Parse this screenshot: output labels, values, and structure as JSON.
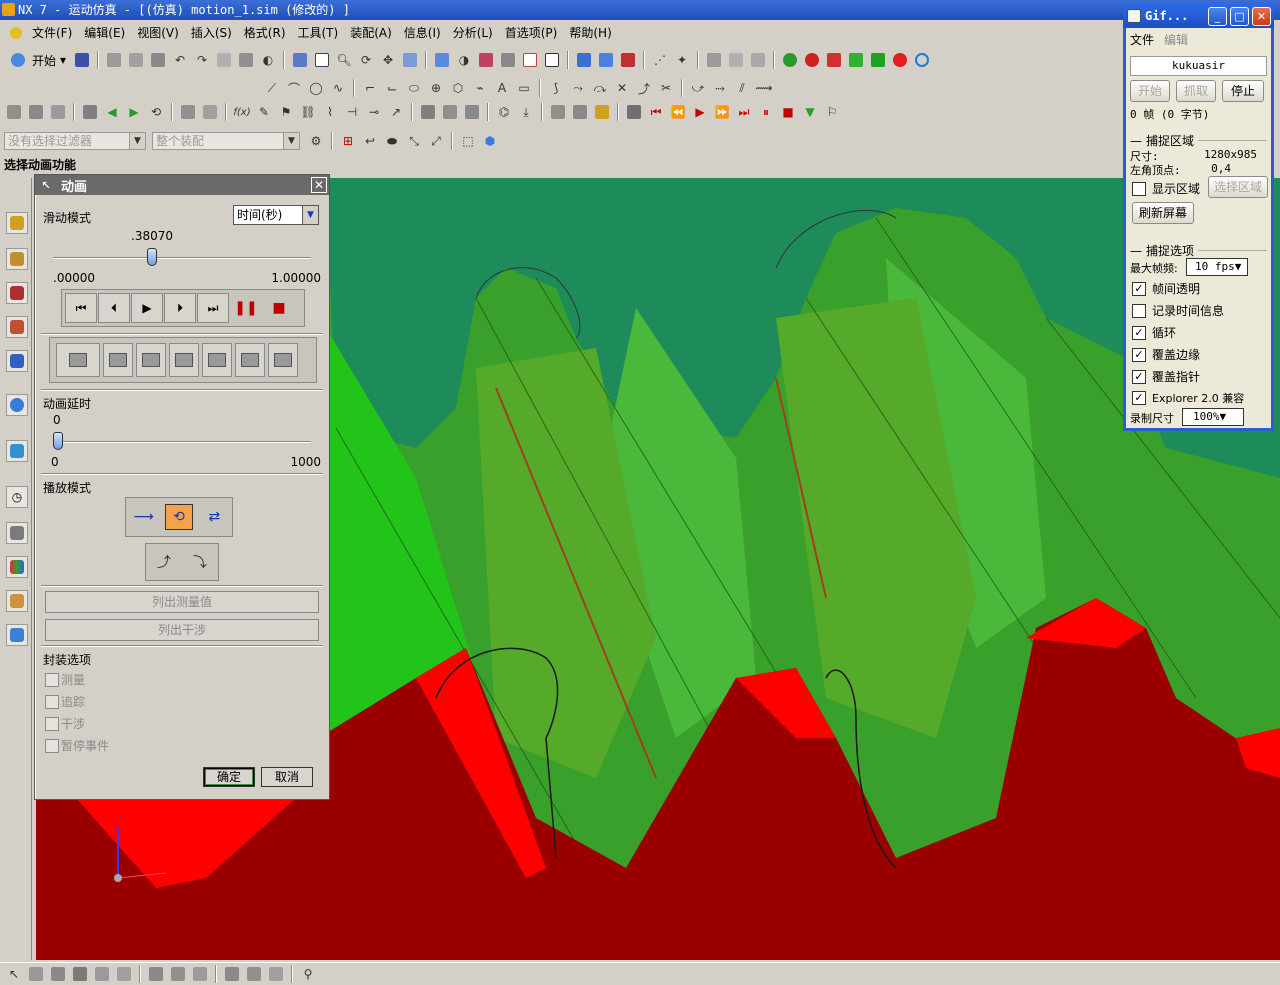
{
  "window": {
    "title": "NX 7 - 运动仿真 - [(仿真) motion_1.sim (修改的) ]"
  },
  "menu": [
    "文件(F)",
    "编辑(E)",
    "视图(V)",
    "插入(S)",
    "格式(R)",
    "工具(T)",
    "装配(A)",
    "信息(I)",
    "分析(L)",
    "首选项(P)",
    "帮助(H)"
  ],
  "toolbar": {
    "start_label": "开始"
  },
  "filter": {
    "selection_filter": "没有选择过滤器",
    "assembly_scope": "整个装配"
  },
  "cue_line": "选择动画功能",
  "animation_dialog": {
    "title": "动画",
    "slide_mode_label": "滑动模式",
    "slide_mode_value": "时间(秒)",
    "time_value": ".38070",
    "time_fraction": 0.3807,
    "time_min": ".00000",
    "time_max": "1.00000",
    "delay_label": "动画延时",
    "delay_value": "0",
    "delay_min": "0",
    "delay_max": "1000",
    "delay_fraction": 0.0,
    "playback_mode_label": "播放模式",
    "list_measurements_label": "列出测量值",
    "list_interference_label": "列出干涉",
    "package_options_label": "封装选项",
    "package_options": [
      "测量",
      "追踪",
      "干涉",
      "暂停事件"
    ],
    "ok_label": "确定",
    "cancel_label": "取消"
  },
  "gif_recorder": {
    "title": "Gif...",
    "menu": [
      "文件",
      "编辑"
    ],
    "user": "kukuasir",
    "start_label": "开始",
    "capture_label": "抓取",
    "stop_label": "停止",
    "frames_text": "0 帧 (0 字节)",
    "capture_region_header": "捕捉区域",
    "size_label": "尺寸:",
    "size_value": "1280x985",
    "corner_label": "左角顶点:",
    "corner_value": "0,4",
    "show_region_label": "显示区域",
    "select_region_label": "选择区域",
    "refresh_label": "刷新屏幕",
    "capture_options_header": "捕捉选项",
    "max_fps_label": "最大帧频:",
    "max_fps_value": "10 fps",
    "options": [
      {
        "label": "帧间透明",
        "checked": true
      },
      {
        "label": "记录时间信息",
        "checked": false
      },
      {
        "label": "循环",
        "checked": true
      },
      {
        "label": "覆盖边缘",
        "checked": true
      },
      {
        "label": "覆盖指针",
        "checked": true
      },
      {
        "label": "Explorer 2.0 兼容",
        "checked": true
      }
    ],
    "record_size_label": "录制尺寸",
    "record_size_value": "100%"
  },
  "colors": {
    "gear_green": "#3aa02c",
    "gear_red": "#ff0000",
    "base_dark_red": "#9b0000",
    "top_teal": "#1e8c5a"
  }
}
